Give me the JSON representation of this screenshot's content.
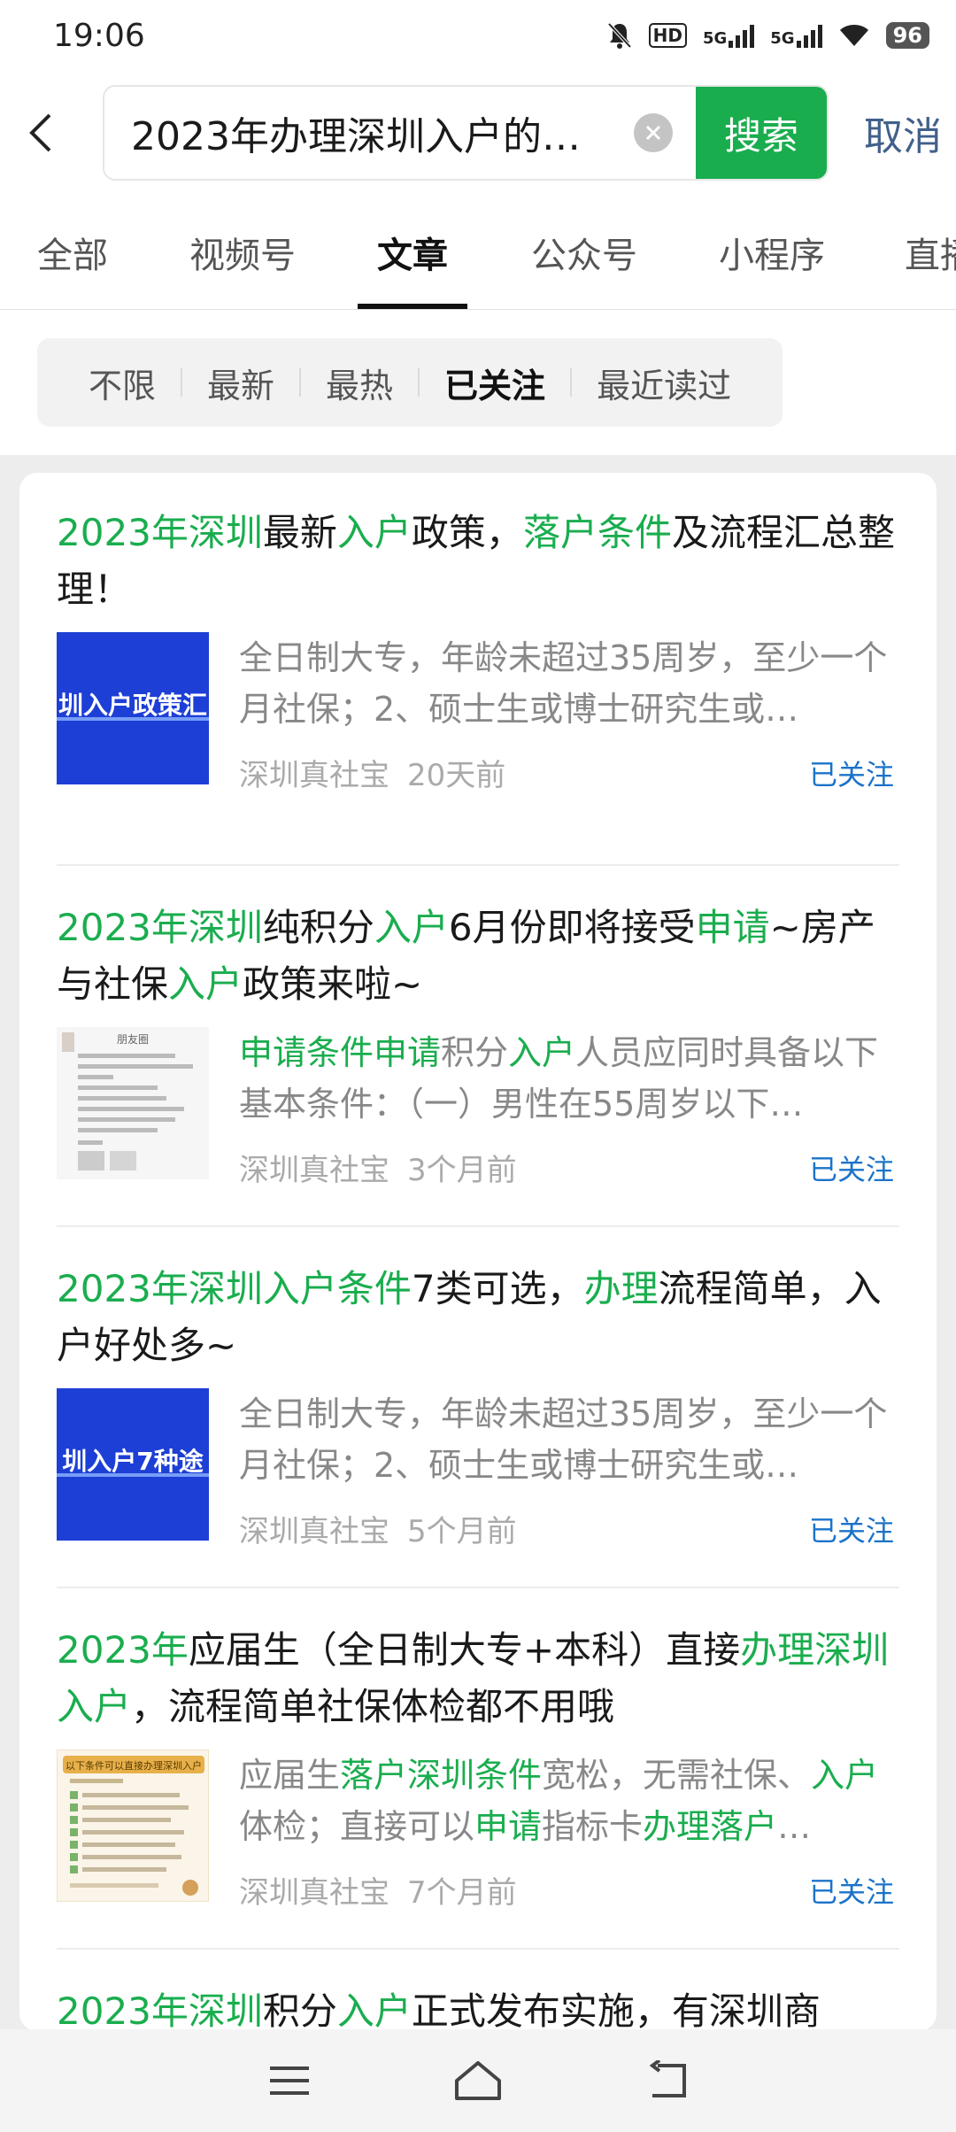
{
  "status": {
    "time": "19:06",
    "battery": "96",
    "hd": "HD",
    "net1": "5G",
    "net2": "5G"
  },
  "search": {
    "query": "2023年办理深圳入户的…",
    "search_label": "搜索",
    "cancel_label": "取消"
  },
  "tabs": [
    {
      "label": "全部"
    },
    {
      "label": "视频号"
    },
    {
      "label": "文章",
      "active": true
    },
    {
      "label": "公众号"
    },
    {
      "label": "小程序"
    },
    {
      "label": "直播"
    }
  ],
  "filters": [
    {
      "label": "不限"
    },
    {
      "label": "最新"
    },
    {
      "label": "最热"
    },
    {
      "label": "已关注",
      "active": true
    },
    {
      "label": "最近读过"
    }
  ],
  "articles": [
    {
      "title": [
        "2023年深圳",
        "最新",
        "入户",
        "政策，",
        "落户条件",
        "及流程汇总整理！"
      ],
      "snippet": [
        "全日制大专，年龄未超过35周岁，至少一个月社保；2、硕士生或博士研究生或…"
      ],
      "thumb_text": "圳入户政策汇",
      "source": "深圳真社宝",
      "time": "20天前",
      "follow": "已关注"
    },
    {
      "title": [
        "2023年深圳",
        "纯积分",
        "入户",
        "6月份即将接受",
        "申请",
        "~房产与社保",
        "入户",
        "政策来啦~"
      ],
      "snippet": [
        "申请条件申请",
        "积分",
        "入户",
        "人员应同时具备以下基本条件：（一）男性在55周岁以下…"
      ],
      "thumb_text": "朋友圈",
      "source": "深圳真社宝",
      "time": "3个月前",
      "follow": "已关注"
    },
    {
      "title": [
        "2023年深圳入户条件",
        "7类可选，",
        "办理",
        "流程简单，入户好处多~"
      ],
      "snippet": [
        "全日制大专，年龄未超过35周岁，至少一个月社保；2、硕士生或博士研究生或…"
      ],
      "thumb_text": "圳入户7种途",
      "source": "深圳真社宝",
      "time": "5个月前",
      "follow": "已关注"
    },
    {
      "title": [
        "2023年",
        "应届生（全日制大专+本科）直接",
        "办理深圳入户",
        "，流程简单社保体检都不用哦"
      ],
      "snippet": [
        "应届生",
        "落户深圳条件",
        "宽松，无需社保、",
        "入户",
        "体检；直接可以",
        "申请",
        "指标卡",
        "办理落户",
        "…"
      ],
      "thumb_text": "以下条件可以直接办理深圳入户",
      "source": "深圳真社宝",
      "time": "7个月前",
      "follow": "已关注"
    },
    {
      "title": [
        "2023年深圳",
        "积分",
        "入户",
        "正式发布实施，有深圳商"
      ]
    }
  ]
}
